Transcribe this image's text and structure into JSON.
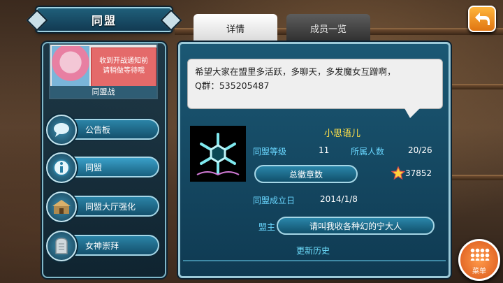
{
  "header": {
    "title": "同盟"
  },
  "battle_card": {
    "notice_line1": "收到开战通知前",
    "notice_line2": "请稍做等待哦",
    "label": "同盟战"
  },
  "sidebar": {
    "items": [
      {
        "label": "公告板",
        "icon": "speech-bubble-icon"
      },
      {
        "label": "同盟",
        "icon": "info-icon"
      },
      {
        "label": "同盟大厅强化",
        "icon": "hall-icon"
      },
      {
        "label": "女神崇拜",
        "icon": "tablet-icon"
      }
    ]
  },
  "tabs": [
    {
      "label": "详情"
    },
    {
      "label": "成员一览"
    }
  ],
  "detail": {
    "message_line1": "希望大家在盟里多活跃，多聊天，多发魔女互蹭啊，",
    "message_line2": "Q群：535205487",
    "guild_name": "小思语儿",
    "level_label": "同盟等级",
    "level_value": "11",
    "members_label": "所属人数",
    "members_value": "20/26",
    "badge_total_button": "总徽章数",
    "badge_total_value": "37852",
    "founded_label": "同盟成立日",
    "founded_value": "2014/1/8",
    "leader_label": "盟主",
    "leader_name": "请叫我收各种幻的宁大人",
    "history_link": "更新历史"
  },
  "fab": {
    "label": "菜单"
  },
  "colors": {
    "accent": "#69d7ff",
    "name": "#ffe14a",
    "orange": "#e07512"
  }
}
